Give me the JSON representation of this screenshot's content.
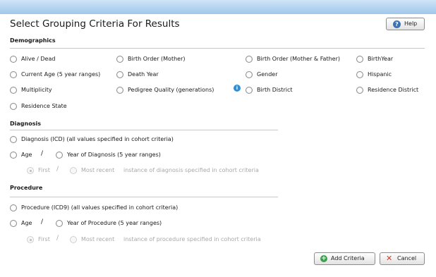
{
  "dialog": {
    "title": "Select Grouping Criteria For Results",
    "help_label": "Help"
  },
  "demographics": {
    "heading": "Demographics",
    "options": [
      "Alive / Dead",
      "Birth Order (Mother)",
      "Birth Order (Mother & Father)",
      "BirthYear",
      "Current Age (5 year ranges)",
      "Death Year",
      "Gender",
      "Hispanic",
      "Multiplicity",
      "Pedigree Quality (generations)",
      "Birth District",
      "Residence District",
      "Residence State"
    ]
  },
  "diagnosis": {
    "heading": "Diagnosis",
    "icd_label": "Diagnosis (ICD) (all values specified in cohort criteria)",
    "age_label": "Age",
    "slash": "/",
    "year_label": "Year of Diagnosis (5 year ranges)",
    "first_label": "First",
    "most_recent_label": "Most recent",
    "instance_text": "instance of diagnosis specified in cohort criteria"
  },
  "procedure": {
    "heading": "Procedure",
    "icd9_label": "Procedure (ICD9) (all values specified in cohort criteria)",
    "age_label": "Age",
    "slash": "/",
    "year_label": "Year of Procedure (5 year ranges)",
    "first_label": "First",
    "most_recent_label": "Most recent",
    "instance_text": "instance of procedure specified in cohort criteria"
  },
  "buttons": {
    "add_criteria": "Add Criteria",
    "cancel": "Cancel"
  },
  "icons": {
    "help": "help-icon",
    "info": "info-icon",
    "add": "plus-circle-icon",
    "cancel": "x-icon"
  },
  "colors": {
    "titlebar": "#b7d5f1",
    "accent": "#3b73b9",
    "add": "#3aa04a",
    "cancel": "#d23b2b"
  }
}
